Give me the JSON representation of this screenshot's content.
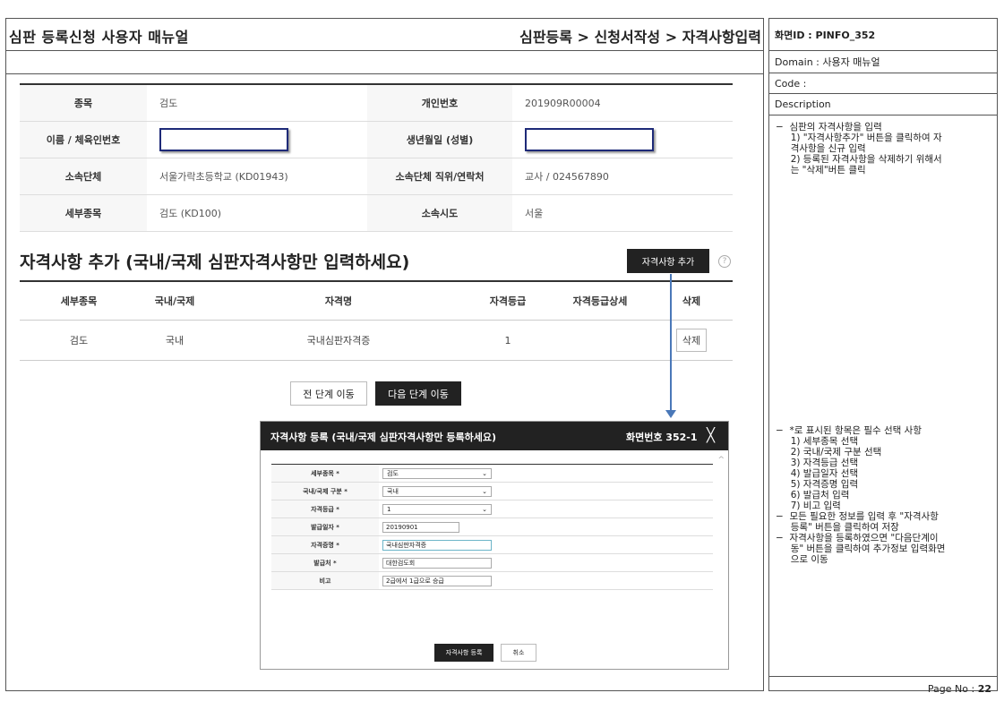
{
  "document": {
    "title": "심판 등록신청 사용자 매뉴얼",
    "breadcrumb": "심판등록 > 신청서작성 > 자격사항입력"
  },
  "side_panel": {
    "screen_id": "화면ID : PINFO_352",
    "domain": "Domain : 사용자 매뉴얼",
    "code": "Code :",
    "description_label": "Description",
    "desc_top": [
      "−  심판의 자격사항을 입력",
      "     1) \"자격사항추가\" 버튼을 클릭하여 자",
      "     격사항을 신규 입력",
      "     2) 등록된 자격사항을 삭제하기 위해서",
      "     는 \"삭제\"버튼 클릭"
    ],
    "desc_bottom": [
      "−  *로 표시된 항목은 필수 선택 사항",
      "     1) 세부종목 선택",
      "     2) 국내/국제 구분 선택",
      "     3) 자격등급 선택",
      "     4) 발급일자 선택",
      "     5) 자격증명 입력",
      "     6) 발급처 입력",
      "     7) 비고 입력",
      "−  모든 필요한 정보를 입력 후 \"자격사항",
      "     등록\" 버튼을 클릭하여 저장",
      "−  자격사항을 등록하였으면 \"다음단계이",
      "     동\" 버튼을 클릭하여 추가정보 입력화면",
      "     으로 이동"
    ],
    "page_label": "Page No : ",
    "page_no": "22"
  },
  "info": {
    "rows": [
      {
        "l1": "종목",
        "v1": "검도",
        "l2": "개인번호",
        "v2": "201909R00004"
      },
      {
        "l1": "이름 / 체육인번호",
        "v1": "",
        "l2": "생년월일 (성별)",
        "v2": ""
      },
      {
        "l1": "소속단체",
        "v1": "서울가락초등학교 (KD01943)",
        "l2": "소속단체 직위/연락처",
        "v2": "교사 / 024567890"
      },
      {
        "l1": "세부종목",
        "v1": "검도 (KD100)",
        "l2": "소속시도",
        "v2": "서울"
      }
    ]
  },
  "qualification": {
    "section_title": "자격사항 추가 (국내/국제 심판자격사항만 입력하세요)",
    "add_button": "자격사항 추가",
    "help": "?",
    "headers": [
      "세부종목",
      "국내/국제",
      "자격명",
      "자격등급",
      "자격등급상세",
      "삭제"
    ],
    "rows": [
      {
        "event": "검도",
        "scope": "국내",
        "name": "국내심판자격증",
        "grade": "1",
        "detail": "",
        "delete": "삭제"
      }
    ],
    "prev_button": "전 단계 이동",
    "next_button": "다음 단계 이동"
  },
  "modal": {
    "title": "자격사항 등록 (국내/국제 심판자격사항만 등록하세요)",
    "screen_no": "화면번호 352-1",
    "close": "╳",
    "fields": {
      "event_label": "세부종목 *",
      "event_value": "검도",
      "scope_label": "국내/국제 구분 *",
      "scope_value": "국내",
      "grade_label": "자격등급 *",
      "grade_value": "1",
      "date_label": "발급일자 *",
      "date_value": "20190901",
      "cert_label": "자격증명 *",
      "cert_value": "국내심판자격증",
      "issuer_label": "발급처 *",
      "issuer_value": "대한검도회",
      "note_label": "비고",
      "note_value": "2급에서 1급으로 승급"
    },
    "register_button": "자격사항 등록",
    "cancel_button": "취소"
  },
  "colors": {
    "dark": "#222222",
    "arrow": "#4a78b8",
    "highlight_box": "#1e2a78"
  }
}
